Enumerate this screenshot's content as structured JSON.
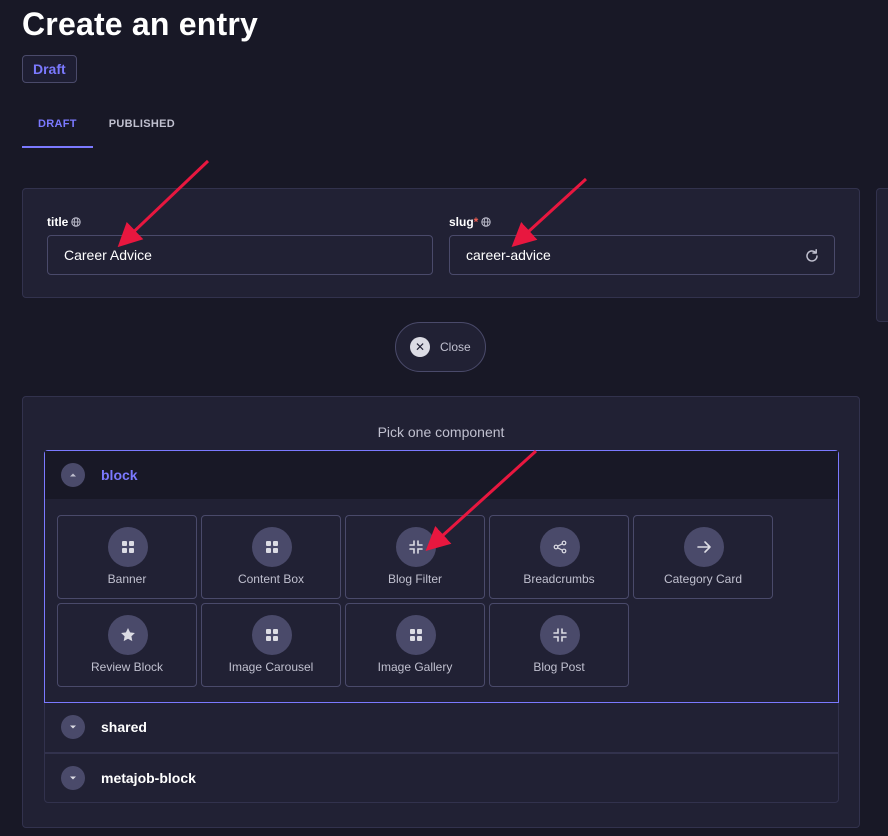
{
  "page": {
    "title": "Create an entry",
    "status_badge": "Draft"
  },
  "tabs": [
    {
      "label": "DRAFT",
      "active": true
    },
    {
      "label": "PUBLISHED",
      "active": false
    }
  ],
  "fields": {
    "title": {
      "label": "title",
      "value": "Career Advice",
      "icon": "globe-icon"
    },
    "slug": {
      "label": "slug",
      "required_mark": "*",
      "value": "career-advice",
      "icon": "globe-icon",
      "action_icon": "refresh-icon"
    }
  },
  "close_button": {
    "label": "Close",
    "icon": "close-icon"
  },
  "picker": {
    "title": "Pick one component",
    "groups": [
      {
        "name": "block",
        "expanded": true,
        "components": [
          {
            "label": "Banner",
            "icon": "grid-icon"
          },
          {
            "label": "Content Box",
            "icon": "grid-icon"
          },
          {
            "label": "Blog Filter",
            "icon": "collapse-icon"
          },
          {
            "label": "Breadcrumbs",
            "icon": "share-icon"
          },
          {
            "label": "Category Card",
            "icon": "arrow-right-icon"
          },
          {
            "label": "Review Block",
            "icon": "star-icon"
          },
          {
            "label": "Image Carousel",
            "icon": "grid-icon"
          },
          {
            "label": "Image Gallery",
            "icon": "grid-icon"
          },
          {
            "label": "Blog Post",
            "icon": "collapse-icon"
          }
        ]
      },
      {
        "name": "shared",
        "expanded": false
      },
      {
        "name": "metajob-block",
        "expanded": false
      }
    ]
  },
  "colors": {
    "background": "#181826",
    "surface": "#212134",
    "border": "#32324d",
    "accent": "#7b79ff",
    "annotation_arrow": "#e8173f"
  }
}
